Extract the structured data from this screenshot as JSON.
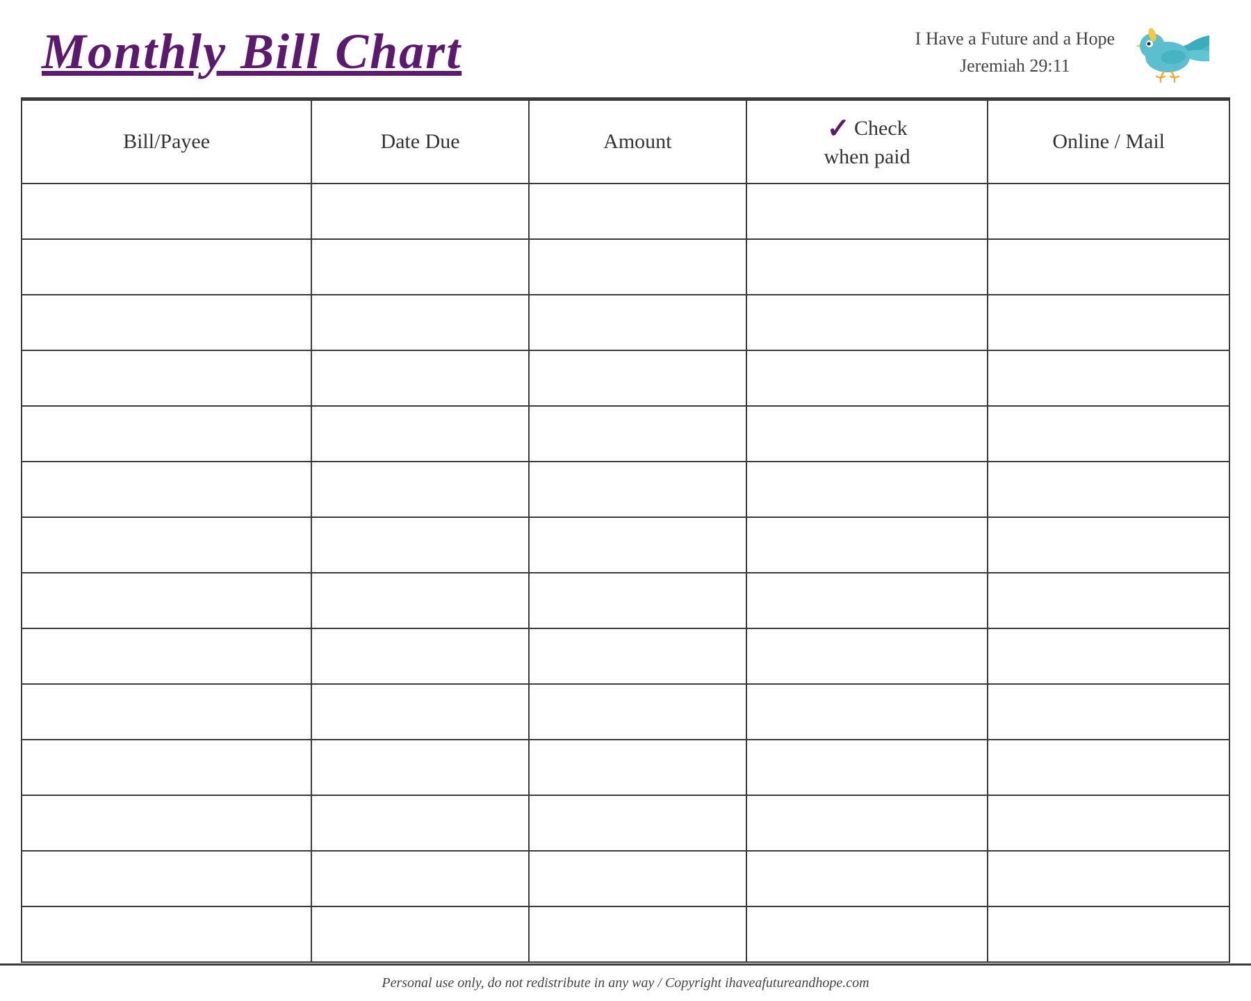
{
  "header": {
    "title": "Monthly Bill Chart",
    "scripture_line1": "I Have a Future and a Hope",
    "scripture_line2": "Jeremiah 29:11"
  },
  "table": {
    "columns": [
      {
        "id": "bill-payee",
        "label": "Bill/Payee"
      },
      {
        "id": "date-due",
        "label": "Date Due"
      },
      {
        "id": "amount",
        "label": "Amount"
      },
      {
        "id": "check-when-paid",
        "label_top": "Check",
        "label_bottom": "when paid",
        "has_checkmark": true
      },
      {
        "id": "online-mail",
        "label": "Online / Mail"
      }
    ],
    "row_count": 14
  },
  "footer": {
    "text": "Personal use only, do not redistribute in any way / Copyright ihaveafutureandhope.com"
  },
  "colors": {
    "title": "#5b1a6e",
    "border": "#3a3a3a",
    "checkmark": "#5b1a6e",
    "text": "#333333",
    "scripture": "#444444"
  }
}
